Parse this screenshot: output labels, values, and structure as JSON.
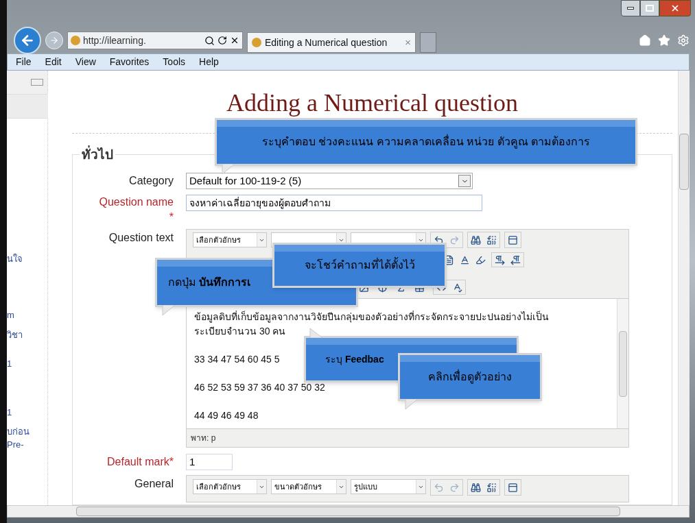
{
  "browser": {
    "address": "http://ilearning.",
    "tab": {
      "title": "Editing a Numerical question",
      "close": "×"
    }
  },
  "menu": [
    "File",
    "Edit",
    "View",
    "Favorites",
    "Tools",
    "Help"
  ],
  "sidebar": {
    "items": [
      "นใจ",
      "m",
      "วิชา",
      "1",
      "1",
      "บก่อน",
      "Pre-"
    ]
  },
  "page": {
    "title": "Adding a Numerical question",
    "section": "ทั่วไป"
  },
  "fields": [
    {
      "kind": "select",
      "label": "Category",
      "required": false,
      "value": "Default for 100-119-2 (5)"
    },
    {
      "kind": "text",
      "label": "Question name",
      "required": true,
      "required_mark": "*",
      "value": "จงหาค่าเฉลี่ยอายุของผู้ตอบศำถาม"
    },
    {
      "kind": "editor",
      "label": "Question text",
      "required": false,
      "font_select": "เลือกตัวอักษร",
      "lines": [
        "ข้อมูลดิบที่เก็บข้อมูลจากงานวิจัยปีนกลุ่มของตัวอย่างที่กระจัดกระจายปะปนอย่างไม่เป็น",
        "ระเบียบจำนวน 30 คน"
      ],
      "paragraphs": [
        "33 34 47 54 60 45 5",
        "46 52 53 59 37 36 40 37 50 32",
        "44 49 46 49 48"
      ],
      "path": "พาท: p"
    },
    {
      "kind": "short",
      "label": "Default mark",
      "required": true,
      "required_mark": "*",
      "value": "1"
    },
    {
      "kind": "toolbar",
      "label": "General",
      "required": false,
      "selects": [
        "เลือกตัวอักษร",
        "ขนาดตัวอักษร",
        "รูปแบบ"
      ]
    }
  ],
  "callouts": [
    {
      "text": "ระบุคำตอบ ช่วงคะแนน ความคลาดเคลื่อน หน่วย ตัวคูณ ตามต้องการ"
    },
    {
      "text": "กดปุ่ม **บันทึกการเ**"
    },
    {
      "text": "จะโชว์คำถามที่ได้ตั้งไว้"
    },
    {
      "text": "ระบุ  **Feedbac**"
    },
    {
      "text": "คลิกเพื่อดูตัวอย่าง"
    }
  ]
}
